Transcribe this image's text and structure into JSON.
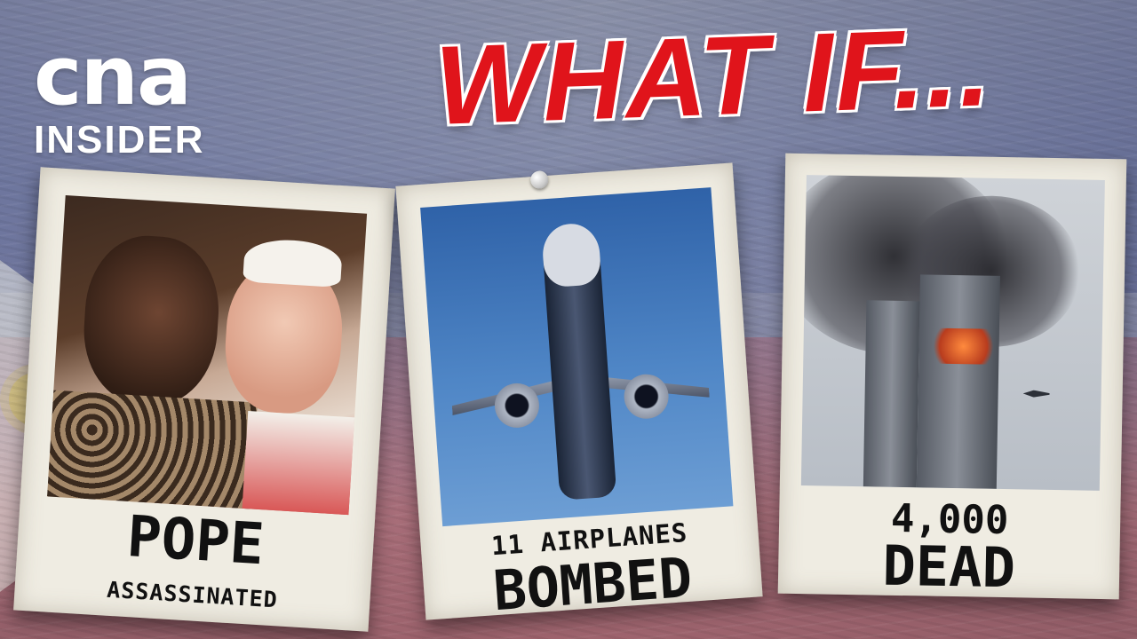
{
  "logo": {
    "brand": "cna",
    "sub": "INSIDER"
  },
  "title": "WHAT IF...",
  "cards": [
    {
      "line1": "POPE",
      "line2": "ASSASSINATED"
    },
    {
      "line1": "11 AIRPLANES",
      "line2": "BOMBED"
    },
    {
      "line1": "4,000",
      "line2": "DEAD"
    }
  ],
  "colors": {
    "title_red": "#e0141b",
    "card_paper": "#efece2",
    "caption_text": "#111111"
  }
}
